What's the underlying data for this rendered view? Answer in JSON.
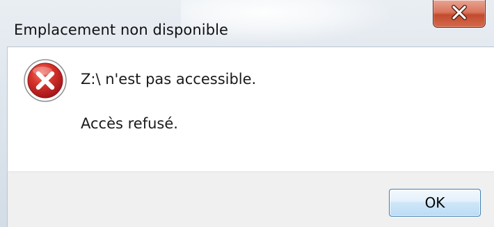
{
  "window": {
    "title": "Emplacement non disponible",
    "close_icon": "close-icon"
  },
  "dialog": {
    "icon": "error-icon",
    "message": "Z:\\ n'est pas accessible.",
    "detail": "Accès refusé."
  },
  "buttons": {
    "ok_label": "OK"
  },
  "colors": {
    "close_button": "#c9553b",
    "error_icon": "#c92a2a",
    "ok_border": "#3c7fb1",
    "content_bg": "#ffffff",
    "footer_bg": "#f0f0f0"
  }
}
